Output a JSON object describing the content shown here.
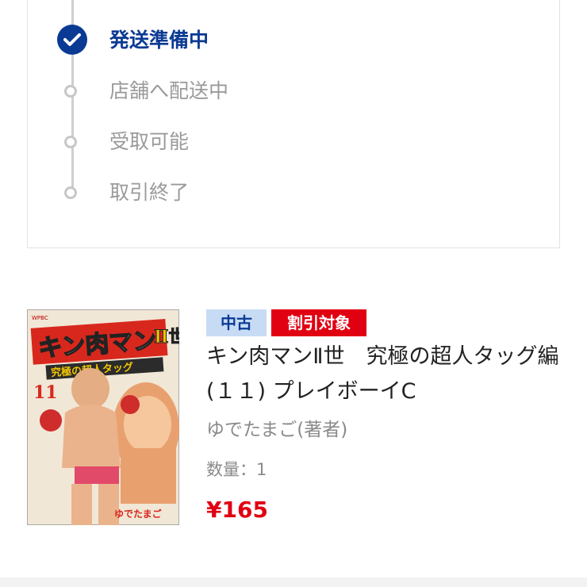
{
  "status": {
    "steps": [
      {
        "label": "発送準備中",
        "state": "done"
      },
      {
        "label": "店舗へ配送中",
        "state": "pending"
      },
      {
        "label": "受取可能",
        "state": "pending"
      },
      {
        "label": "取引終了",
        "state": "pending"
      }
    ]
  },
  "product": {
    "badges": {
      "used": "中古",
      "sale": "割引対象"
    },
    "title": "キン肉マンⅡ世　究極の超人タッグ編(１１) プレイボーイC",
    "author": "ゆでたまご(著者)",
    "quantity": "数量：1",
    "price": "¥165",
    "cover": {
      "title": "キン肉マン",
      "subtitle": "究極の超人タッグ",
      "volume": "11",
      "author": "ゆでたまご",
      "publisher": "WPBC",
      "series_mark": "Ⅱ世"
    }
  },
  "colors": {
    "accent": "#0b3a94",
    "sale": "#e00012",
    "muted": "#9a9a9a"
  }
}
